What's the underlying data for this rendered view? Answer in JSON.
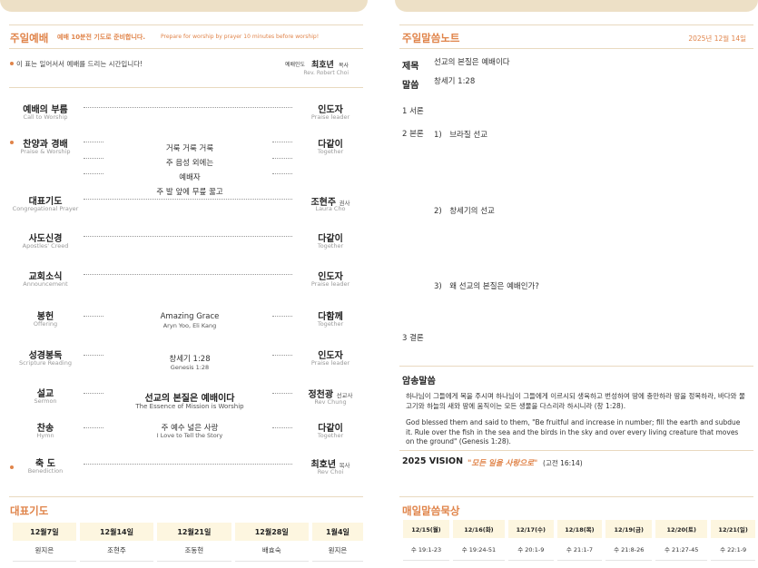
{
  "left": {
    "section_title": "주일예배",
    "prep_ko": "예배 10분전 기도로 준비합니다.",
    "prep_en": "Prepare for worship by prayer 10 minutes before worship!",
    "bullet_note": "이 표는 일어서서 예배를 드리는 시간입니다!",
    "preacher_label": "예배인도",
    "preacher_name": "최호년",
    "preacher_title": "목사",
    "preacher_en": "Rev. Robert Choi",
    "order": [
      {
        "title": "예배의 부름",
        "sub": "Call to Worship",
        "leader": "인도자",
        "leader_sub": "Praise leader"
      },
      {
        "title": "찬양과 경배",
        "sub": "Praise & Worship",
        "lines": [
          "거룩 거룩 거룩",
          "주 음성 외에는",
          "예배자",
          "주 발 앞에 무릎 꿇고"
        ],
        "leader": "다같이",
        "leader_sub": "Together"
      },
      {
        "title": "대표기도",
        "sub": "Congregational Prayer",
        "leader": "조현주",
        "leader_title": "권사",
        "leader_sub": "Laura Cho"
      },
      {
        "title": "사도신경",
        "sub": "Apostles' Creed",
        "leader": "다같이",
        "leader_sub": "Together"
      },
      {
        "title": "교회소식",
        "sub": "Announcement",
        "leader": "인도자",
        "leader_sub": "Praise leader"
      },
      {
        "title": "봉헌",
        "sub": "Offering",
        "content": "Amazing Grace",
        "content_sub": "Aryn Yoo, Eli Kang",
        "leader": "다함께",
        "leader_sub": "Together"
      },
      {
        "title": "성경봉독",
        "sub": "Scripture Reading",
        "content": "창세기 1:28",
        "content_sub": "Genesis 1:28",
        "leader": "인도자",
        "leader_sub": "Praise leader"
      },
      {
        "title": "설교",
        "sub": "Sermon",
        "content": "선교의 본질은 예배이다",
        "content_sub": "The Essence of Mission is Worship",
        "leader": "정천광",
        "leader_title": "선교사",
        "leader_sub": "Rev Chung"
      },
      {
        "title": "찬송",
        "sub": "Hymn",
        "content": "주 예수 넓은 사랑",
        "content_sub": "I Love to Tell the Story",
        "leader": "다같이",
        "leader_sub": "Together"
      },
      {
        "title": "축 도",
        "sub": "Benediction",
        "leader": "최호년",
        "leader_title": "목사",
        "leader_sub": "Rev Choi"
      }
    ],
    "prayer_title": "대표기도",
    "prayer_table": {
      "headers": [
        "12월7일",
        "12월14일",
        "12월21일",
        "12월28일",
        "1월4일"
      ],
      "names": [
        "원지은",
        "조현주",
        "조동현",
        "배효숙",
        "원지은"
      ]
    }
  },
  "right": {
    "section_title": "주일말씀노트",
    "date": "2025년 12월 14일",
    "title_label": "제목",
    "title_value": "선교의 본질은 예배이다",
    "word_label": "말씀",
    "word_value": "창세기 1:28",
    "intro": "1 서론",
    "body": "2 본론",
    "points": [
      "1)　브라질 선교",
      "2)　창세기의 선교",
      "3)　왜 선교의 본질은 예배인가?"
    ],
    "conclusion": "3 결론",
    "memory_title": "암송말씀",
    "memory_ko": "하나님이 그들에게 복을 주시며 하나님이 그들에게 이르시되 생육하고 번성하여 땅에 충만하라 땅을 정복하라, 바다와 물고기와 하늘의 새와 땅에 움직이는 모든 생물을 다스리라 하시니라 (창 1:28).",
    "memory_en": "God blessed them and said to them, \"Be fruitful and increase in number; fill the earth and subdue it. Rule over the fish in the sea and the birds in the sky and over every living creature that moves on the ground\" (Genesis 1:28).",
    "vision_label": "2025 VISION",
    "vision_quote": "\"모든 일을 사랑으로\"",
    "vision_ref": "(고전 16:14)",
    "daily_title": "매일말씀묵상",
    "daily_table": {
      "headers": [
        "12/15(월)",
        "12/16(화)",
        "12/17(수)",
        "12/18(목)",
        "12/19(금)",
        "12/20(토)",
        "12/21(일)"
      ],
      "refs": [
        "수 19:1-23",
        "수 19:24-51",
        "수 20:1-9",
        "수 21:1-7",
        "수 21:8-26",
        "수 21:27-45",
        "수 22:1-9"
      ]
    }
  }
}
